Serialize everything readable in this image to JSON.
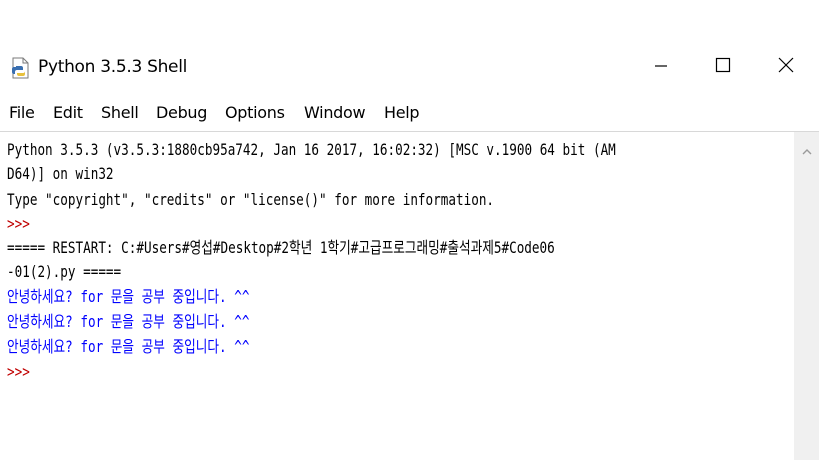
{
  "window": {
    "title": "Python 3.5.3 Shell",
    "icon": "python-file-icon",
    "controls": [
      "minimize-icon",
      "maximize-icon",
      "close-icon"
    ]
  },
  "menu": [
    "File",
    "Edit",
    "Shell",
    "Debug",
    "Options",
    "Window",
    "Help"
  ],
  "shell": {
    "lines": [
      {
        "text": "Python 3.5.3 (v3.5.3:1880cb95a742, Jan 16 2017, 16:02:32) [MSC v.1900 64 bit (AM",
        "kind": "normal"
      },
      {
        "text": "D64)] on win32",
        "kind": "normal"
      },
      {
        "text": "Type \"copyright\", \"credits\" or \"license()\" for more information.",
        "kind": "normal"
      },
      {
        "text": ">>> ",
        "kind": "prompt"
      },
      {
        "text": "===== RESTART: C:#Users#영섭#Desktop#2학년 1학기#고급프로그래밍#출석과제5#Code06",
        "kind": "normal"
      },
      {
        "text": "-01(2).py =====",
        "kind": "normal"
      },
      {
        "text": "안녕하세요? for 문을 공부 중입니다. ^^",
        "kind": "output"
      },
      {
        "text": "안녕하세요? for 문을 공부 중입니다. ^^",
        "kind": "output"
      },
      {
        "text": "안녕하세요? for 문을 공부 중입니다. ^^",
        "kind": "output"
      },
      {
        "text": ">>> ",
        "kind": "prompt"
      }
    ]
  },
  "colors": {
    "prompt": "#c00000",
    "output": "#0000ff",
    "text": "#000000"
  }
}
